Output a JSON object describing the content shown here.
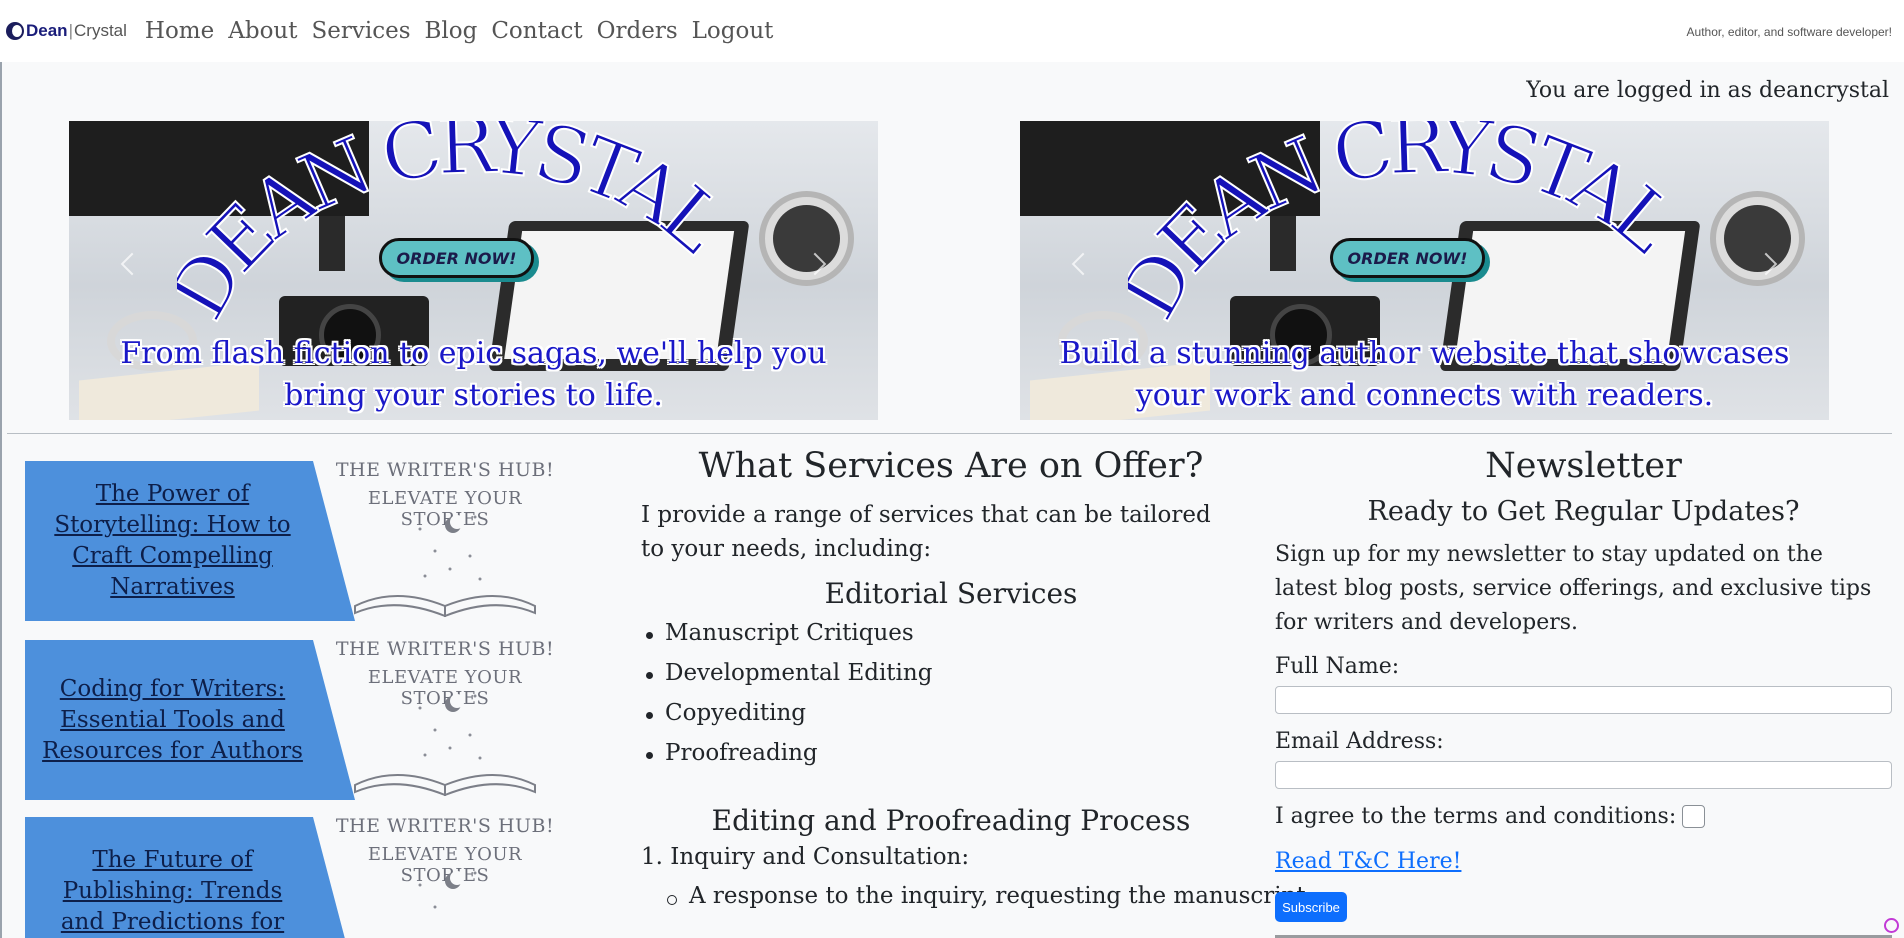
{
  "nav": {
    "brand_first": "Dean",
    "brand_sep": "|",
    "brand_second": "Crystal",
    "links": [
      "Home",
      "About",
      "Services",
      "Blog",
      "Contact",
      "Orders",
      "Logout"
    ],
    "tagline": "Author, editor, and software developer!"
  },
  "user": {
    "logged_in_text": "You are logged in as deancrystal"
  },
  "banners": [
    {
      "heading": "DEAN CRYSTAL",
      "badge": "ORDER NOW!",
      "text_line1": "From flash fiction to epic sagas, we'll help you",
      "text_line2": "bring your stories to life."
    },
    {
      "heading": "DEAN CRYSTAL",
      "badge": "ORDER NOW!",
      "text_line1": "Build a stunning author website that showcases",
      "text_line2": "your work and connects with readers."
    }
  ],
  "blog": {
    "hub_line1": "THE WRITER'S HUB!",
    "hub_line2": "ELEVATE YOUR STORIES",
    "posts": [
      {
        "title": "The Power of Storytelling: How to Craft Compelling Narratives"
      },
      {
        "title": "Coding for Writers: Essential Tools and Resources for Authors"
      },
      {
        "title": "The Future of Publishing: Trends and Predictions for the"
      }
    ]
  },
  "services": {
    "heading": "What Services Are on Offer?",
    "intro": "I provide a range of services that can be tailored to your needs, including:",
    "editorial_heading": "Editorial Services",
    "editorial_items": [
      "Manuscript Critiques",
      "Developmental Editing",
      "Copyediting",
      "Proofreading"
    ],
    "process_heading": "Editing and Proofreading Process",
    "step1": "1. Inquiry and Consultation:",
    "step1_sub": "A response to the inquiry, requesting the manuscript"
  },
  "newsletter": {
    "heading": "Newsletter",
    "subheading": "Ready to Get Regular Updates?",
    "text": "Sign up for my newsletter to stay updated on the latest blog posts, service offerings, and exclusive tips for writers and developers.",
    "name_label": "Full Name:",
    "name_value": "",
    "email_label": "Email Address:",
    "email_value": "",
    "agree_label": "I agree to the terms and conditions:",
    "tc_link": "Read T&C Here!",
    "subscribe_label": "Subscribe"
  },
  "colors": {
    "accent": "#0d6efd",
    "card_blue": "#4d90dc",
    "banner_text": "#1a18c8"
  }
}
